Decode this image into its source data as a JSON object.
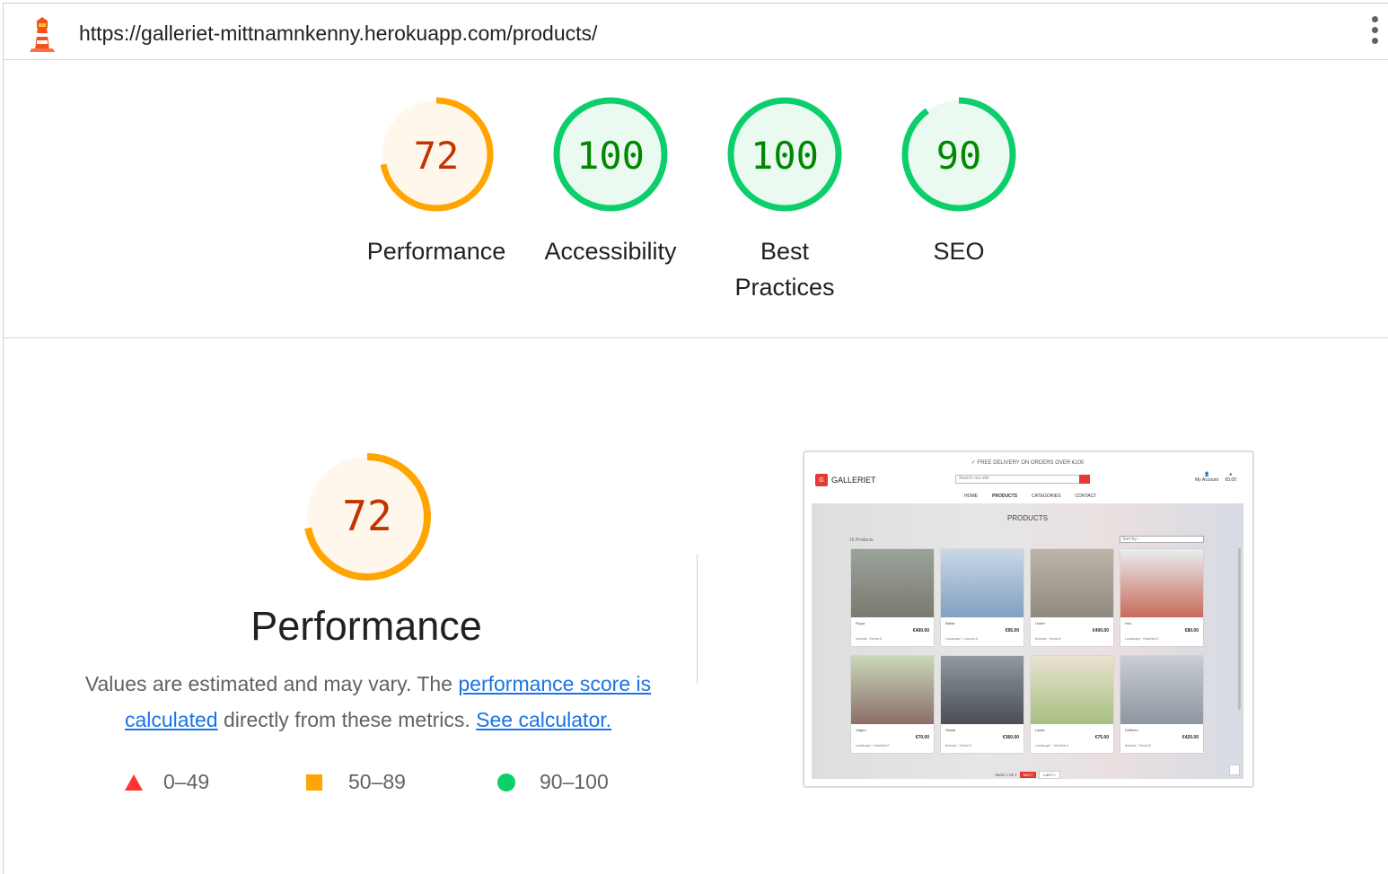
{
  "topbar": {
    "url": "https://galleriet-mittnamnkenny.herokuapp.com/products/"
  },
  "colors": {
    "fail": "#ff3333",
    "average": "#ffa400",
    "pass": "#0cce6b",
    "average_text": "#c33300",
    "pass_text": "#008800",
    "link": "#1a73e8"
  },
  "gauges": [
    {
      "score": "72",
      "value": 72,
      "label": "Performance",
      "rating": "average"
    },
    {
      "score": "100",
      "value": 100,
      "label": "Accessibility",
      "rating": "pass"
    },
    {
      "score": "100",
      "value": 100,
      "label": "Best Practices",
      "rating": "pass"
    },
    {
      "score": "90",
      "value": 90,
      "label": "SEO",
      "rating": "pass"
    }
  ],
  "performance": {
    "score": "72",
    "value": 72,
    "title": "Performance",
    "desc_text1": "Values are estimated and may vary. The ",
    "desc_link1": "performance score is calculated",
    "desc_text2": " directly from these metrics. ",
    "desc_link2": "See calculator."
  },
  "legend": [
    {
      "icon": "triangle-icon",
      "range": "0–49"
    },
    {
      "icon": "square-icon",
      "range": "50–89"
    },
    {
      "icon": "circle-icon",
      "range": "90–100"
    }
  ],
  "screenshot": {
    "banner": "✓ FREE DELIVERY ON ORDERS OVER €100",
    "brand": "GALLERIET",
    "brand_mark": "G",
    "search_placeholder": "Search our site",
    "account": "My Account",
    "bag_total": "€0.00",
    "nav": [
      "HOME",
      "PRODUCTS",
      "CATEGORIES",
      "CONTACT"
    ],
    "page_title": "PRODUCTS",
    "count": "16 Products",
    "sort": "Sort by...",
    "products": [
      {
        "name": "Pippa",
        "price": "€400.00",
        "meta": "Animals · Serina E"
      },
      {
        "name": "Bärlar",
        "price": "€95.00",
        "meta": "Landscape · Lorenzo A"
      },
      {
        "name": "Under",
        "price": "€400.00",
        "meta": "Animals · Serina E"
      },
      {
        "name": "Hus",
        "price": "€80.00",
        "meta": "Landscape · Kidseline E"
      },
      {
        "name": "Vägen",
        "price": "€70.00",
        "meta": "Landscape · Kidseline E"
      },
      {
        "name": "Skatar",
        "price": "€360.00",
        "meta": "Animals · Serina E"
      },
      {
        "name": "Lasse",
        "price": "€75.00",
        "meta": "Landscape · Veronika A"
      },
      {
        "name": "Delfinen",
        "price": "€420.00",
        "meta": "Animals · Serina E"
      }
    ],
    "pager": "PAGE 1 OF 2",
    "next": "NEXT",
    "last": "LAST »"
  }
}
